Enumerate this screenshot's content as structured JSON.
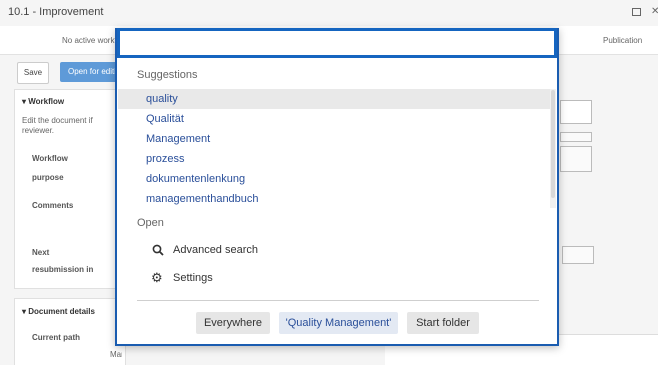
{
  "window": {
    "title": "10.1 - Improvement"
  },
  "workflow_bar": {
    "left_text": "No active workflow",
    "right_text": "Publication"
  },
  "toolbar": {
    "save_label": "Save",
    "open_label": "Open for editing"
  },
  "workflow_panel": {
    "title": "Workflow",
    "description": "Edit the document if reviewer.",
    "workflow_label": "Workflow",
    "purpose_label": "purpose",
    "comments_label": "Comments",
    "next_label": "Next",
    "resubmission_label": "resubmission in"
  },
  "document_panel": {
    "title": "Document details",
    "current_path_label": "Current path",
    "current_path_value": "Manual"
  },
  "search": {
    "query": "",
    "suggestions_header": "Suggestions",
    "suggestions": [
      "quality",
      "Qualität",
      "Management",
      "prozess",
      "dokumentenlenkung",
      "managementhandbuch"
    ],
    "open_header": "Open",
    "options": [
      {
        "label": "Advanced search",
        "icon": "search-icon"
      },
      {
        "label": "Settings",
        "icon": "gear-icon"
      }
    ],
    "scopes": [
      "Everywhere",
      "'Quality Management'",
      "Start folder"
    ],
    "active_scope_index": 1
  },
  "colors": {
    "accent": "#1565c0",
    "link": "#2a4f9a",
    "primary_button": "#5e9ad8"
  }
}
